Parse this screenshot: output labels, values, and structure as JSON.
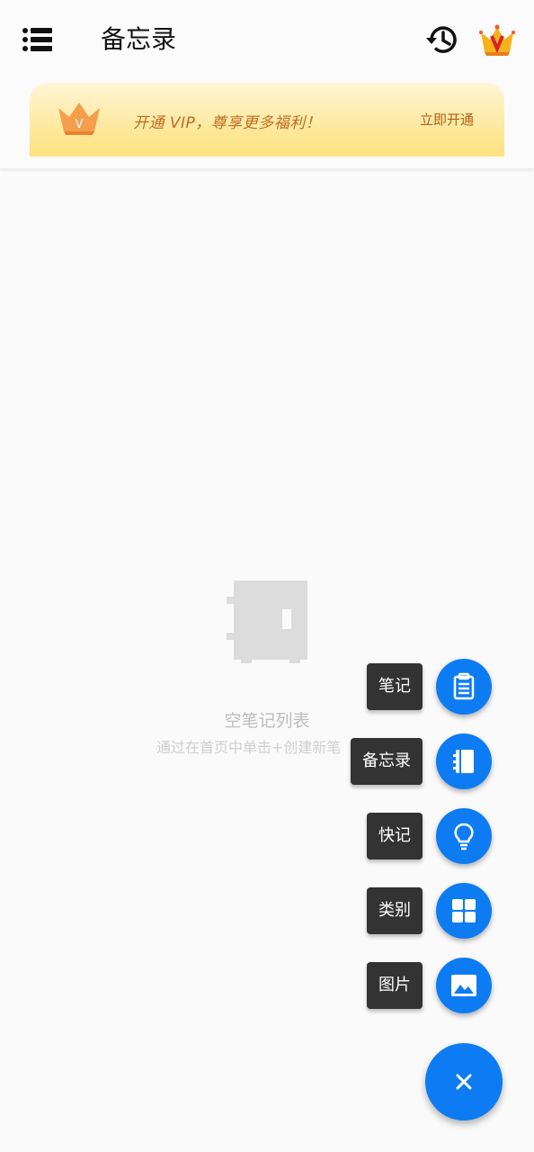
{
  "header": {
    "title": "备忘录",
    "icons": {
      "menu": "list-menu-icon",
      "history": "history-icon",
      "vip": "vip-crown-icon"
    }
  },
  "vip_banner": {
    "promo_text": "开通 VIP，尊享更多福利！",
    "action_label": "立即开通"
  },
  "empty_state": {
    "title": "空笔记列表",
    "subtitle": "通过在首页中单击+创建新笔"
  },
  "speed_dial": {
    "items": [
      {
        "label": "笔记",
        "icon": "clipboard-icon"
      },
      {
        "label": "备忘录",
        "icon": "notebook-icon"
      },
      {
        "label": "快记",
        "icon": "lightbulb-icon"
      },
      {
        "label": "类别",
        "icon": "grid-icon"
      },
      {
        "label": "图片",
        "icon": "image-icon"
      }
    ],
    "main_button_icon": "close-icon"
  },
  "colors": {
    "accent": "#0d7cf2",
    "label_bg": "#333333",
    "vip_text": "#c06a22"
  }
}
